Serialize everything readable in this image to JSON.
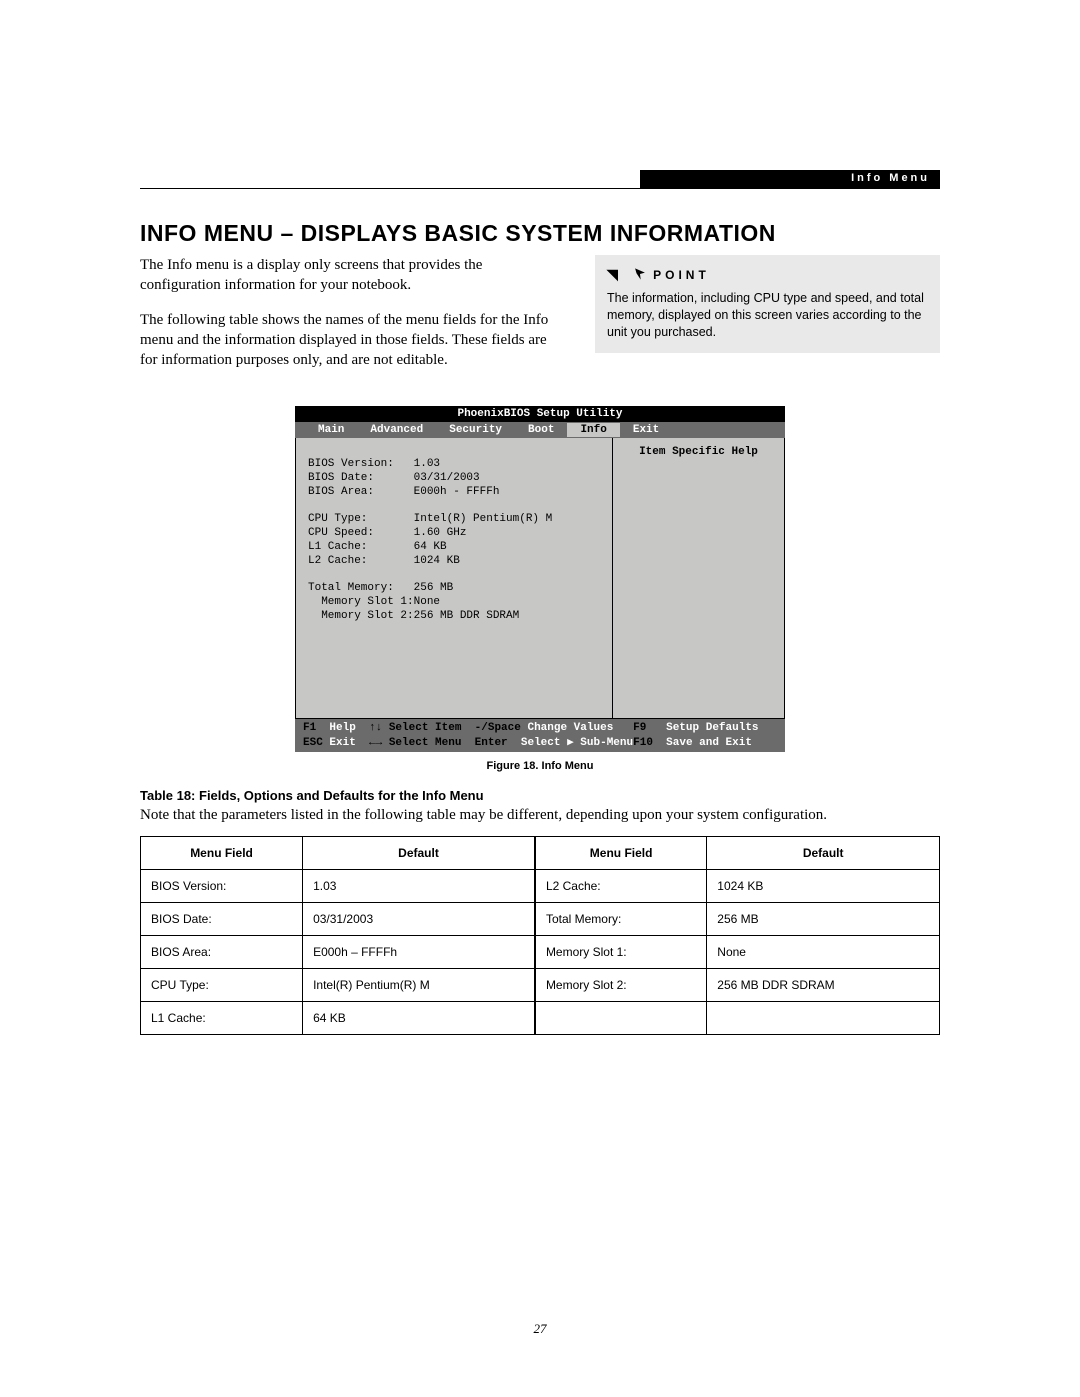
{
  "header_label": "Info Menu",
  "heading": "INFO MENU – DISPLAYS BASIC SYSTEM INFORMATION",
  "para1": "The Info menu is a display only screens that provides the configuration information for your notebook.",
  "para2": "The following table shows the names of the menu fields for the Info menu and the information displayed in those fields. These fields are for information purposes only, and are not editable.",
  "point": {
    "label": "POINT",
    "body": "The information, including CPU type and speed, and total memory, displayed on this screen varies according to the unit you purchased."
  },
  "bios": {
    "title": "PhoenixBIOS Setup Utility",
    "tabs": [
      "Main",
      "Advanced",
      "Security",
      "Boot",
      "Info",
      "Exit"
    ],
    "active_tab": "Info",
    "help_title": "Item Specific Help",
    "fields": [
      {
        "label": "BIOS Version:",
        "value": "1.03"
      },
      {
        "label": "BIOS Date:",
        "value": "03/31/2003"
      },
      {
        "label": "BIOS Area:",
        "value": "E000h - FFFFh"
      },
      {
        "label": "",
        "value": ""
      },
      {
        "label": "CPU Type:",
        "value": "Intel(R) Pentium(R) M"
      },
      {
        "label": "CPU Speed:",
        "value": "1.60 GHz"
      },
      {
        "label": "L1 Cache:",
        "value": "64 KB"
      },
      {
        "label": "L2 Cache:",
        "value": "1024 KB"
      },
      {
        "label": "",
        "value": ""
      },
      {
        "label": "Total Memory:",
        "value": "256 MB"
      },
      {
        "label": "  Memory Slot 1:",
        "value": "None"
      },
      {
        "label": "  Memory Slot 2:",
        "value": "256 MB DDR SDRAM"
      }
    ],
    "footer": {
      "line1": {
        "f1": "F1",
        "help": "Help",
        "sel_item": "↑↓ Select Item",
        "chg": "-/Space",
        "chg_lbl": "Change Values",
        "f9": "F9",
        "def": "Setup Defaults"
      },
      "line2": {
        "esc": "ESC",
        "exit": "Exit",
        "sel_menu": "←→ Select Menu",
        "enter": "Enter",
        "sub": "Select ▶ Sub-Menu",
        "f10": "F10",
        "save": "Save and Exit"
      }
    }
  },
  "figure_caption": "Figure 18.  Info Menu",
  "table_title": "Table 18: Fields, Options and Defaults for the Info Menu",
  "table_note": "Note that the parameters listed in the following table may be different, depending upon your system configuration.",
  "table": {
    "headers": [
      "Menu Field",
      "Default",
      "Menu Field",
      "Default"
    ],
    "rows": [
      [
        "BIOS Version:",
        "1.03",
        "L2 Cache:",
        "1024 KB"
      ],
      [
        "BIOS Date:",
        "03/31/2003",
        "Total Memory:",
        "256 MB"
      ],
      [
        "BIOS Area:",
        "E000h – FFFFh",
        "Memory Slot 1:",
        "None"
      ],
      [
        "CPU Type:",
        "Intel(R) Pentium(R) M",
        "Memory Slot 2:",
        "256 MB DDR SDRAM"
      ],
      [
        "L1 Cache:",
        "64 KB",
        "",
        ""
      ]
    ]
  },
  "page_number": "27"
}
